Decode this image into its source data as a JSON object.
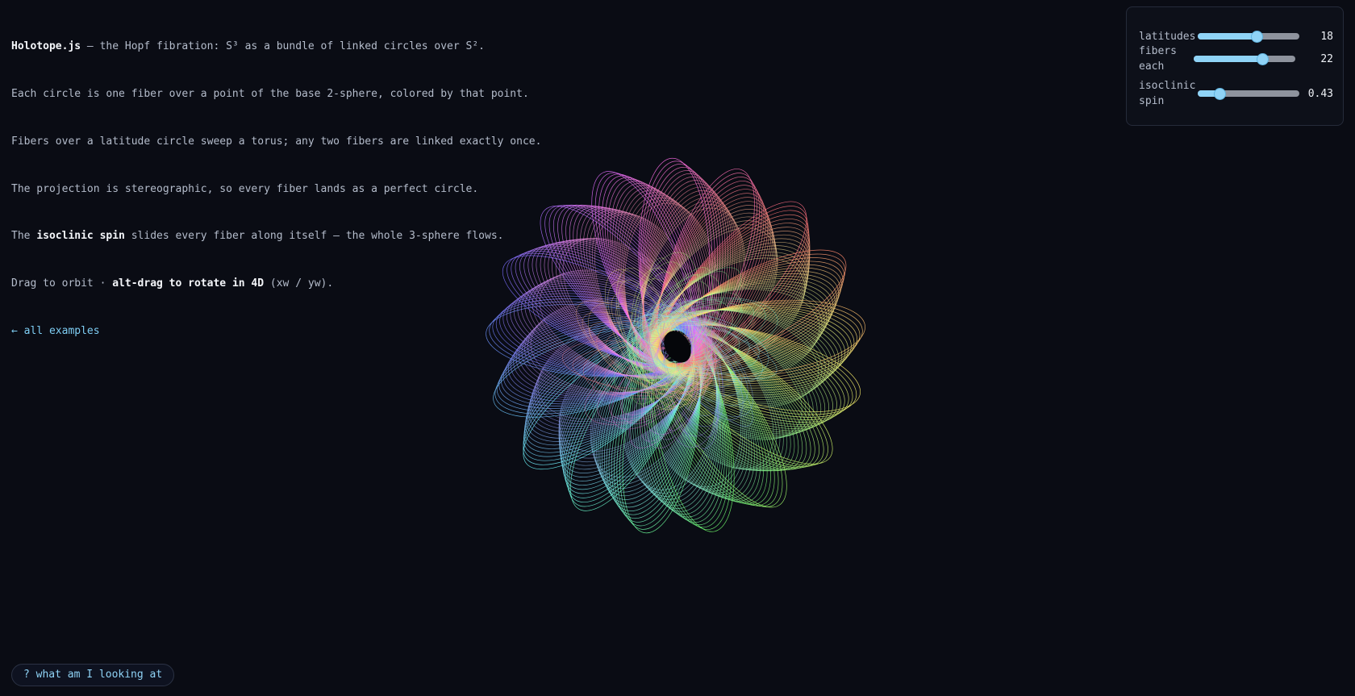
{
  "intro": {
    "brand": "Holotope.js",
    "line1_rest": " — the Hopf fibration: S³ as a bundle of linked circles over S².",
    "line2": "Each circle is one fiber over a point of the base 2-sphere, colored by that point.",
    "line3": "Fibers over a latitude circle sweep a torus; any two fibers are linked exactly once.",
    "line4": "The projection is stereographic, so every fiber lands as a perfect circle.",
    "line5_pre": "The ",
    "line5_bold": "isoclinic spin",
    "line5_post": " slides every fiber along itself — the whole 3-sphere flows.",
    "line6_pre": "Drag to orbit · ",
    "line6_bold": "alt-drag to rotate in 4D",
    "line6_post": " (xw / yw).",
    "back_link": "← all examples"
  },
  "controls": {
    "latitudes": {
      "label": "latitudes",
      "value": 18,
      "min": 1,
      "max": 30,
      "display": "18"
    },
    "fibers": {
      "label": "fibers\neach",
      "value": 22,
      "min": 1,
      "max": 32,
      "display": "22"
    },
    "spin": {
      "label": "isoclinic\nspin",
      "value": 0.43,
      "min": 0,
      "max": 2,
      "display": "0.43"
    }
  },
  "help_button": "? what am I looking at",
  "colors": {
    "background": "#0a0c14",
    "accent": "#8fd3f6",
    "link": "#7ecdf3"
  }
}
